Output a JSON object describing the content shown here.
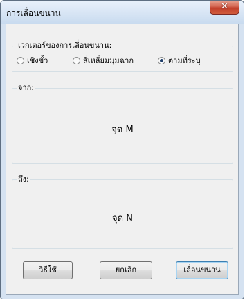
{
  "window": {
    "title": "การเลื่อนขนาน",
    "close_glyph": "✕"
  },
  "vector_group": {
    "label": "เวกเตอร์ของการเลื่อนขนาน:",
    "options": [
      {
        "label": "เชิงขั้ว",
        "checked": false
      },
      {
        "label": "สี่เหลี่ยมมุมฉาก",
        "checked": false
      },
      {
        "label": "ตามที่ระบุ",
        "checked": true
      }
    ]
  },
  "from_group": {
    "label": "จาก:",
    "value": "จุด M"
  },
  "to_group": {
    "label": "ถึง:",
    "value": "จุด N"
  },
  "buttons": {
    "help": "วิธีใช้",
    "cancel": "ยกเลิก",
    "translate": "เลื่อนขนาน"
  }
}
